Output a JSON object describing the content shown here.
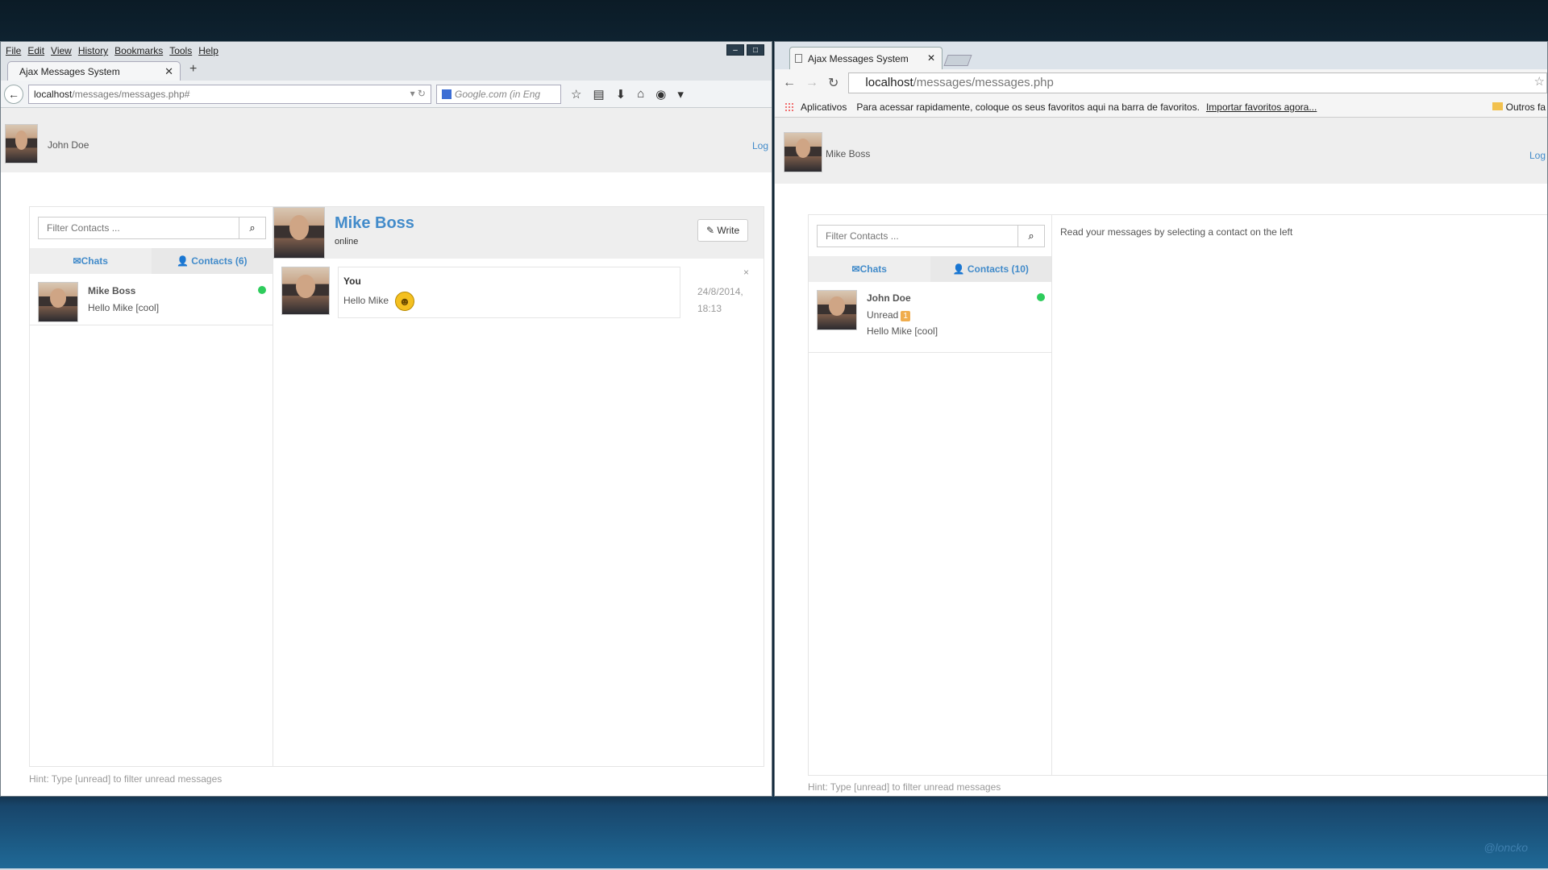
{
  "firefox": {
    "menu": [
      "File",
      "Edit",
      "View",
      "History",
      "Bookmarks",
      "Tools",
      "Help"
    ],
    "tab_title": "Ajax Messages System",
    "url_host": "localhost",
    "url_path": "/messages/messages.php#",
    "search_placeholder": "Google.com (in Eng",
    "app": {
      "user": "John Doe",
      "logout": "Log",
      "filter_placeholder": "Filter Contacts ...",
      "tab_chats": "✉Chats",
      "tab_contacts": "👤 Contacts (6)",
      "contact": {
        "name": "Mike Boss",
        "preview": "Hello Mike [cool]"
      },
      "chat": {
        "name": "Mike Boss",
        "status": "online",
        "write": "✎ Write",
        "message": {
          "author": "You",
          "text": "Hello Mike",
          "date": "24/8/2014,",
          "time": "18:13",
          "close": "×"
        }
      },
      "hint": "Hint: Type [unread] to filter unread messages"
    }
  },
  "chrome": {
    "tab_title": "Ajax Messages System",
    "url_host": "localhost",
    "url_path": "/messages/messages.php",
    "bookmarks": {
      "apps": "Aplicativos",
      "text": "Para acessar rapidamente, coloque os seus favoritos aqui na barra de favoritos.",
      "link": "Importar favoritos agora...",
      "other": "Outros fa"
    },
    "app": {
      "user": "Mike Boss",
      "logout": "Log",
      "filter_placeholder": "Filter Contacts ...",
      "tab_chats": "✉Chats",
      "tab_contacts": "👤 Contacts (10)",
      "contact": {
        "name": "John Doe",
        "unread": "Unread",
        "unread_count": "1",
        "preview": "Hello Mike [cool]"
      },
      "empty_text": "Read your messages by selecting a contact on the left",
      "hint": "Hint: Type [unread] to filter unread messages"
    }
  },
  "desktop": {
    "watermark": "@loncko"
  },
  "colors": {
    "link": "#428bca",
    "online": "#2ecc5c",
    "badge": "#f0ad4e"
  }
}
